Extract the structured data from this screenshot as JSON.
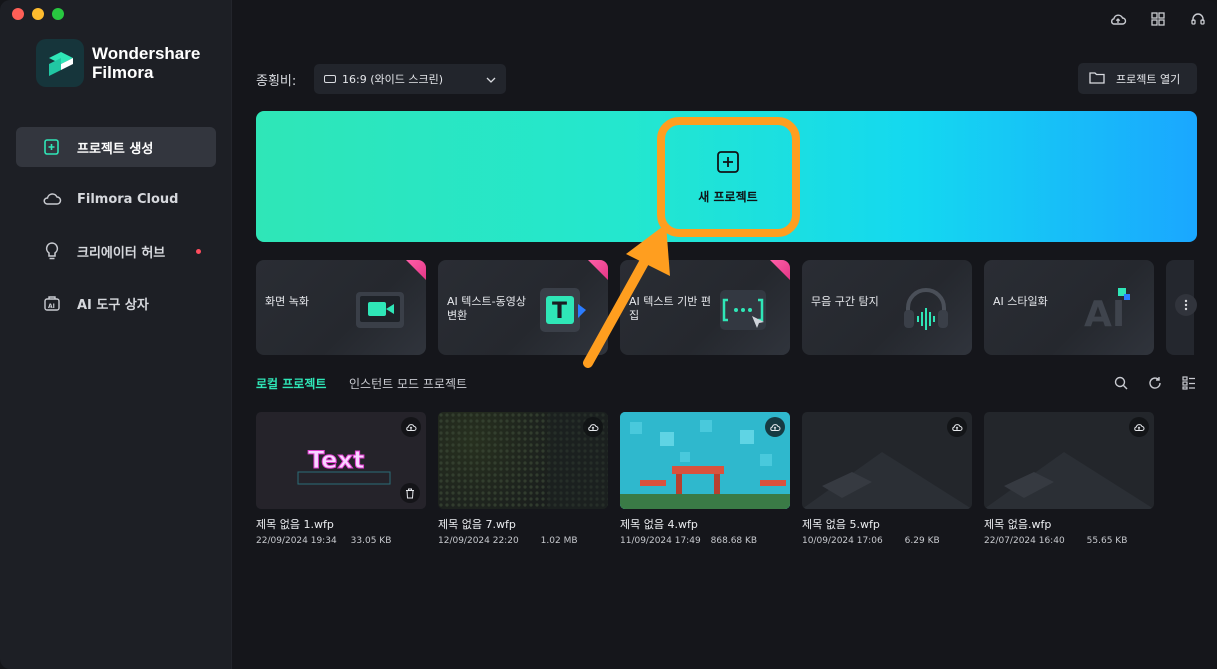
{
  "brand": {
    "line1": "Wondershare",
    "line2": "Filmora"
  },
  "sidebar": {
    "items": [
      {
        "label": "프로젝트 생성",
        "icon": "new-project-icon",
        "active": true
      },
      {
        "label": "Filmora Cloud",
        "icon": "cloud-icon",
        "active": false
      },
      {
        "label": "크리에이터 허브",
        "icon": "lightbulb-icon",
        "active": false,
        "dot": true
      },
      {
        "label": "AI 도구 상자",
        "icon": "ai-toolbox-icon",
        "active": false
      }
    ]
  },
  "top_icons": [
    "cloud-upload-icon",
    "grid-apps-icon",
    "headset-icon"
  ],
  "aspect": {
    "label": "종횡비:",
    "value": "16:9 (와이드 스크린)"
  },
  "open_project": {
    "label": "프로젝트 열기"
  },
  "hero": {
    "new_project_label": "새 프로젝트"
  },
  "tools": [
    {
      "label": "화면 녹화",
      "badge": true,
      "icon": "screen-record-icon"
    },
    {
      "label": "AI 텍스트-동영상 변환",
      "badge": true,
      "icon": "text-to-video-icon"
    },
    {
      "label": "AI 텍스트 기반 편집",
      "badge": true,
      "icon": "text-edit-icon"
    },
    {
      "label": "무음 구간 탐지",
      "badge": false,
      "icon": "silence-detect-icon"
    },
    {
      "label": "AI 스타일화",
      "badge": false,
      "icon": "ai-stylize-icon"
    }
  ],
  "tabs": {
    "local": "로컬 프로젝트",
    "instant": "인스턴트 모드 프로젝트"
  },
  "projects": [
    {
      "name": "제목 없음 1.wfp",
      "date": "22/09/2024 19:34",
      "size": "33.05 KB",
      "thumb_text": "Text",
      "trash": true
    },
    {
      "name": "제목 없음 7.wfp",
      "date": "12/09/2024 22:20",
      "size": "1.02 MB"
    },
    {
      "name": "제목 없음 4.wfp",
      "date": "11/09/2024 17:49",
      "size": "868.68 KB"
    },
    {
      "name": "제목 없음 5.wfp",
      "date": "10/09/2024 17:06",
      "size": "6.29 KB"
    },
    {
      "name": "제목 없음.wfp",
      "date": "22/07/2024 16:40",
      "size": "55.65 KB"
    }
  ],
  "colors": {
    "accent": "#2fe6b7",
    "highlight": "#ff9e1f",
    "sidebar_bg": "#1d1f25",
    "bg": "#15161b"
  }
}
